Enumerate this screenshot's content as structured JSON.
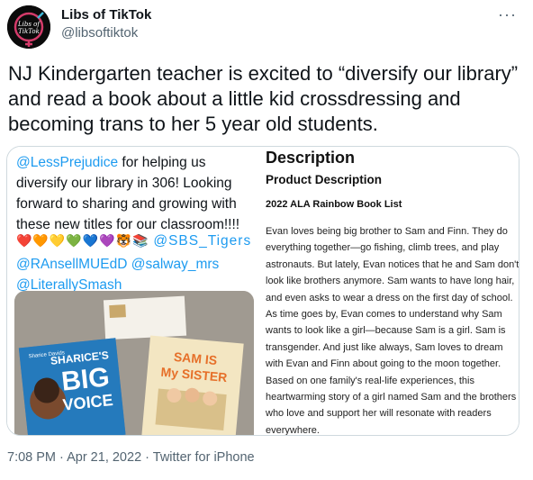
{
  "author": {
    "name": "Libs of TikTok",
    "handle": "@libsoftiktok",
    "avatar_text": "Libs of TikTok"
  },
  "more_label": "···",
  "tweet_text": "NJ Kindergarten teacher is excited to “diversify our library” and read a book about a little kid crossdressing and  becoming trans to her 5 year old students.",
  "embedded_tweet": {
    "mention1": "@LessPrejudice",
    "text1": " for helping us diversify our library in 306! Looking forward to sharing and growing with these new titles for our classroom!!!!",
    "emojis": "❤️🧡💛💚💙💜🐯📚",
    "mention2": "@SBS_Tigers",
    "mention3": "@RAnsellMUEdD",
    "mention4": "@salway_mrs",
    "mention5": "@LiterallySmash",
    "book1": {
      "title_line1": "SHARICE'S",
      "title_line2": "BIG",
      "title_line3": "VOICE",
      "author": "Sharice Davids"
    },
    "book2": {
      "title_line1": "SAM IS",
      "title_line2": "My SISTER"
    }
  },
  "description": {
    "heading": "Description",
    "subheading": "Product Description",
    "award": "2022 ALA Rainbow Book List",
    "body": "Evan loves being big brother to Sam and Finn. They do everything together—go fishing, climb trees, and play astronauts. But lately, Evan notices that he and Sam don't look like brothers anymore. Sam wants to have long hair, and even asks to wear a dress on the first day of school. As time goes by, Evan comes to understand why Sam wants to look like a girl—because Sam is a girl. Sam is transgender. And just like always, Sam loves to dream with Evan and Finn about going to the moon together. Based on one family's real-life experiences, this heartwarming story of a girl named Sam and the brothers who love and support her will resonate with readers everywhere."
  },
  "footer": {
    "time": "7:08 PM",
    "sep1": " · ",
    "date": "Apr 21, 2022",
    "sep2": " · ",
    "source": "Twitter for iPhone"
  },
  "colors": {
    "link": "#1d9bf0",
    "text": "#0f1419",
    "secondary": "#536471",
    "border": "#cfd9de"
  }
}
